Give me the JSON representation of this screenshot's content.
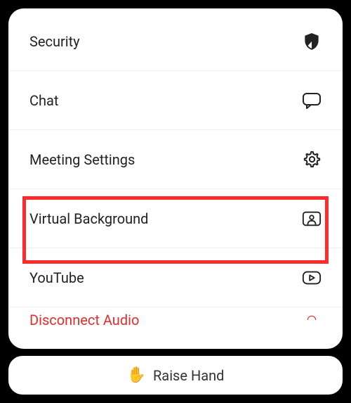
{
  "menu": {
    "items": [
      {
        "label": "Security",
        "icon": "shield-icon"
      },
      {
        "label": "Chat",
        "icon": "chat-icon"
      },
      {
        "label": "Meeting Settings",
        "icon": "gear-icon"
      },
      {
        "label": "Virtual Background",
        "icon": "person-frame-icon"
      },
      {
        "label": "YouTube",
        "icon": "youtube-icon"
      },
      {
        "label": "Disconnect Audio",
        "icon": "disconnect-icon"
      }
    ]
  },
  "bottom": {
    "raise_label": "Raise Hand",
    "raise_emoji": "✋"
  },
  "highlight_index": 3
}
